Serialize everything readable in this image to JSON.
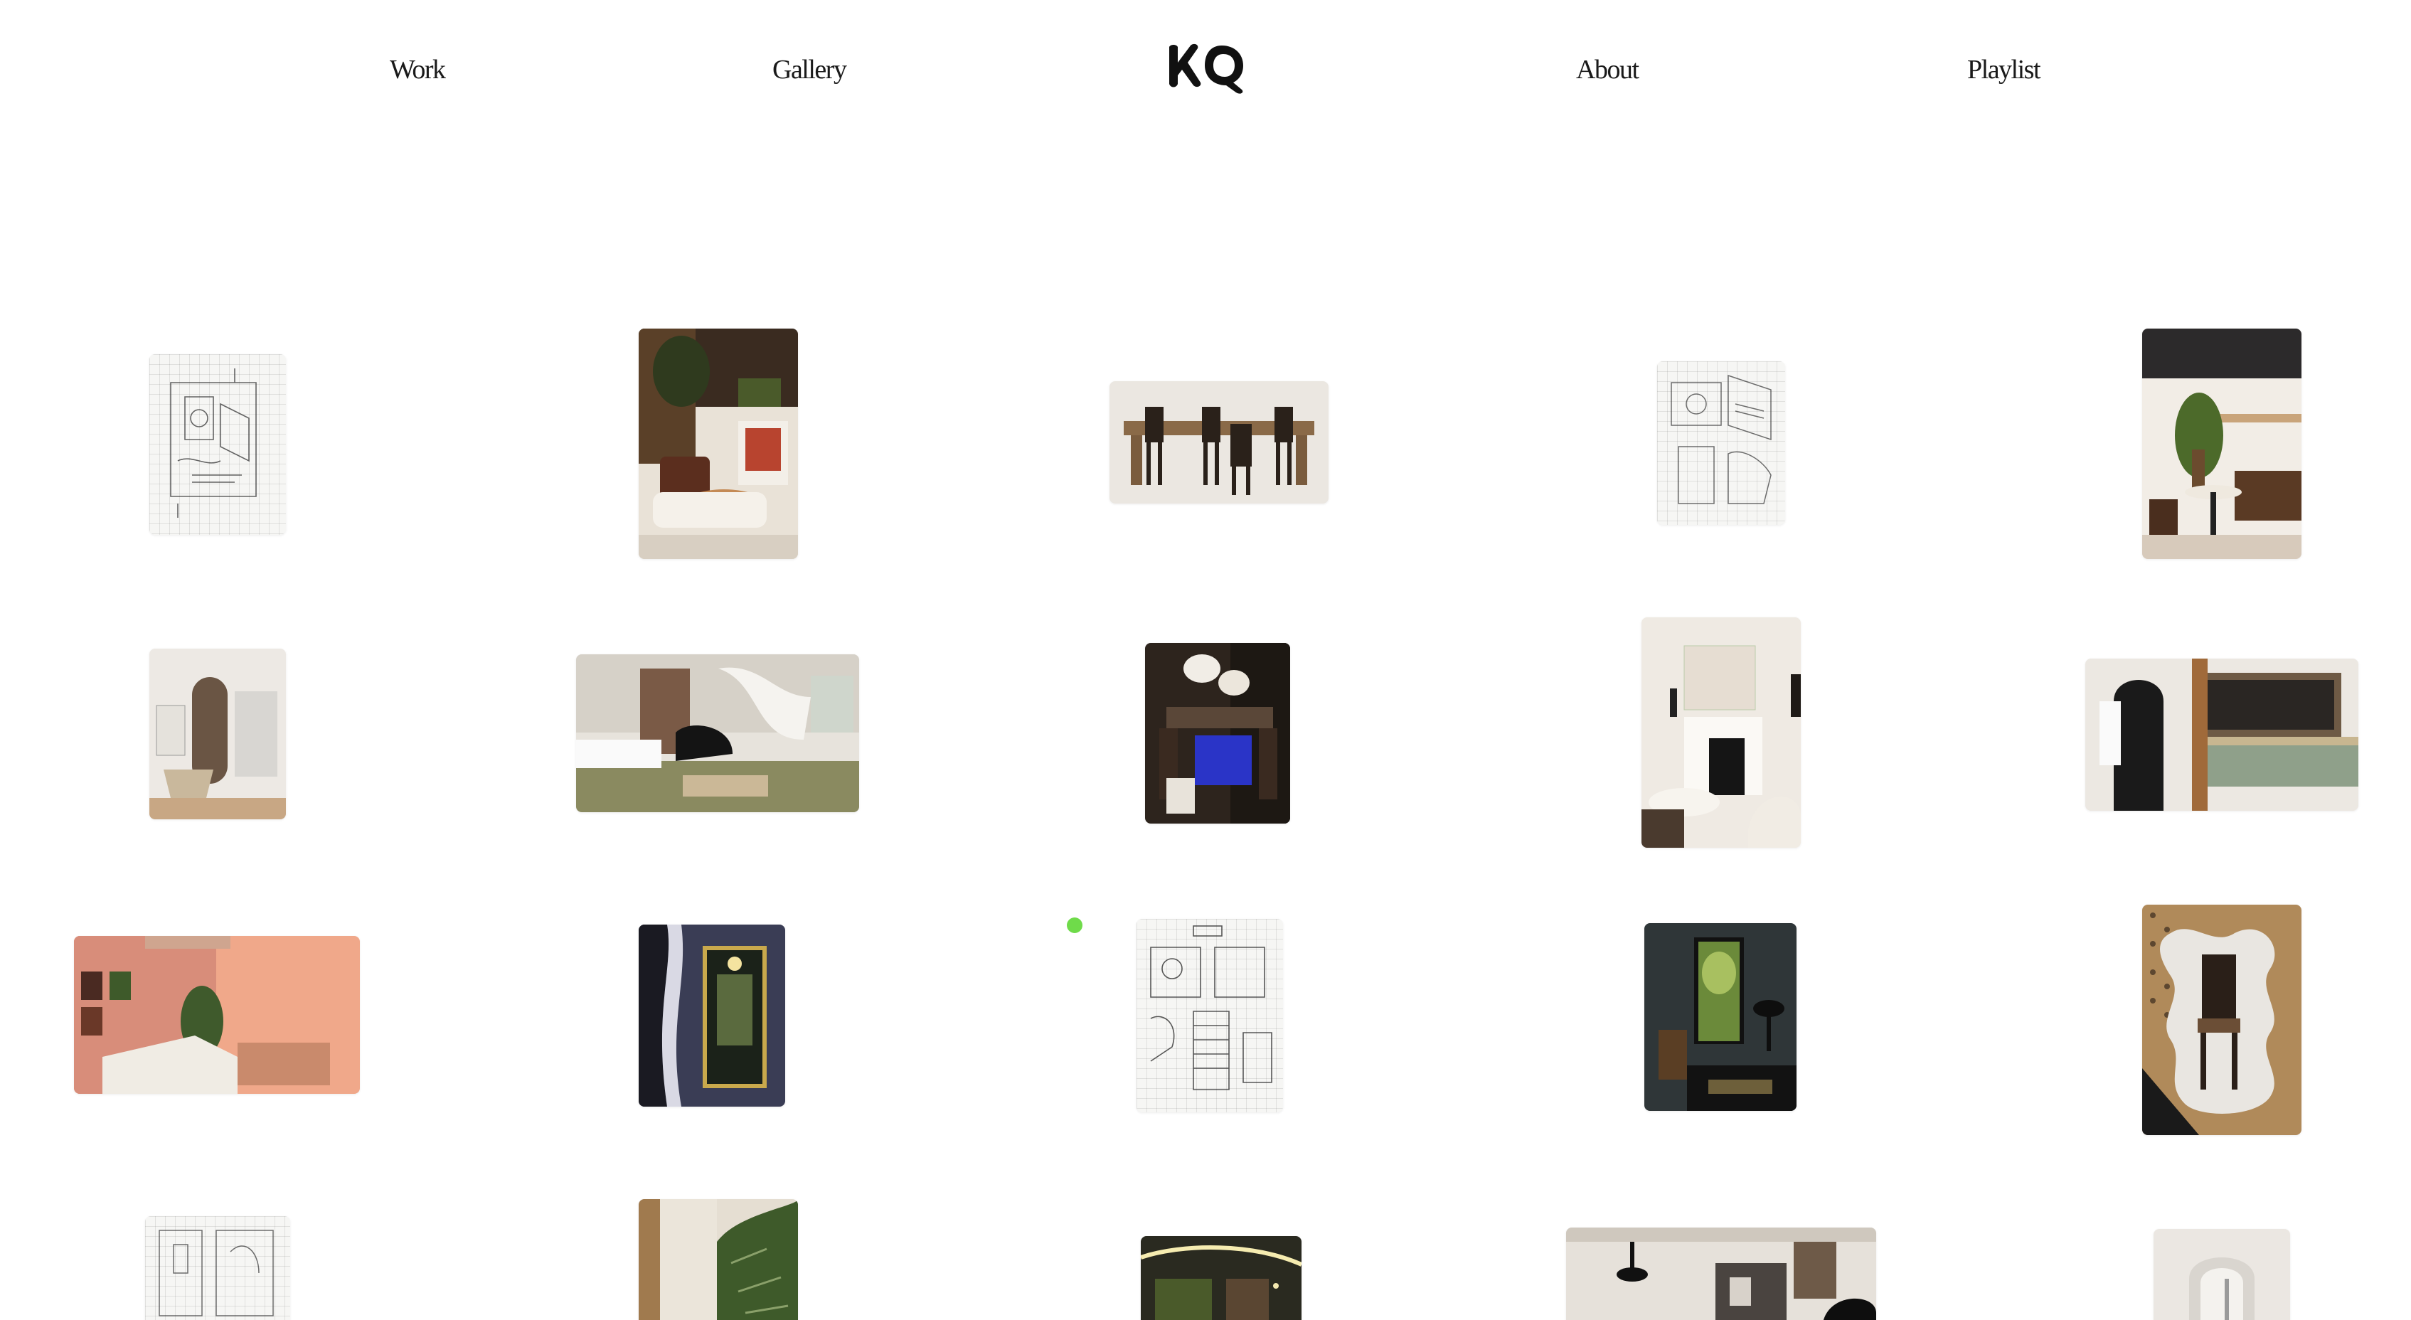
{
  "nav": {
    "work": "Work",
    "gallery": "Gallery",
    "about": "About",
    "playlist": "Playlist"
  },
  "logo": {
    "text": "KQ"
  },
  "colors": {
    "background": "#ffffff",
    "text": "#1a1a1a",
    "cursor": "#6fdb4a"
  },
  "gallery": {
    "row1": [
      "sketch-floorplan",
      "living-room-render",
      "dining-table-render",
      "sketch-furniture",
      "cafe-bench-render"
    ],
    "row2": [
      "bathroom-render",
      "grand-piano-living-render",
      "blue-dining-render",
      "fireplace-render",
      "bathroom-wood-render"
    ],
    "row3": [
      "pink-bedroom-render",
      "dark-doorway-render",
      "sketch-shelving",
      "green-window-render",
      "wavy-chair-render"
    ],
    "row4": [
      "sketch-elevations",
      "marble-panel-render",
      "lit-ceiling-render",
      "piano-lounge-render",
      "arched-niche-render"
    ]
  }
}
